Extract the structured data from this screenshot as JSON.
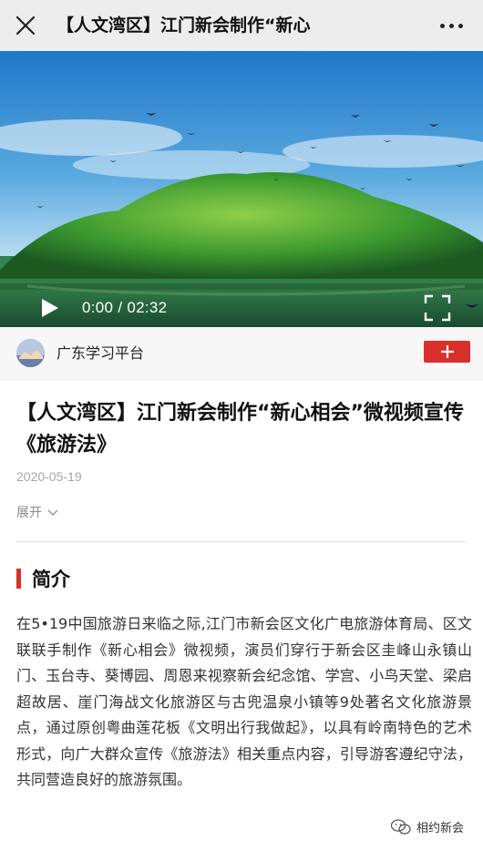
{
  "topbar": {
    "title": "【人文湾区】江门新会制作“新心",
    "close_icon": "close-icon",
    "more_icon": "more-dots-icon"
  },
  "video": {
    "current_time": "0:00",
    "separator": "/",
    "duration": "02:32",
    "play_icon": "play-icon",
    "fullscreen_icon": "fullscreen-icon",
    "progress": 0
  },
  "account": {
    "name": "广东学习平台",
    "add_icon": "plus-icon",
    "add_color": "#d8302a"
  },
  "article": {
    "headline": "【人文湾区】江门新会制作“新心相会”微视频宣传《旅游法》",
    "date": "2020-05-19",
    "expand_label": "展开",
    "section_title": "简介",
    "body": "在5•19中国旅游日来临之际,江门市新会区文化广电旅游体育局、区文联联手制作《新心相会》微视频，演员们穿行于新会区圭峰山永镇山门、玉台寺、葵博园、周恩来视察新会纪念馆、学宫、小鸟天堂、梁启超故居、崖门海战文化旅游区与古兜温泉小镇等9处著名文化旅游景点，通过原创粤曲莲花板《文明出行我做起》，以具有岭南特色的艺术形式，向广大群众宣传《旅游法》相关重点内容，引导游客遵纪守法，共同营造良好的旅游氛围。"
  },
  "watermark": {
    "text": "相约新会"
  },
  "colors": {
    "accent": "#d8302a",
    "topbar_bg": "#ededed"
  }
}
